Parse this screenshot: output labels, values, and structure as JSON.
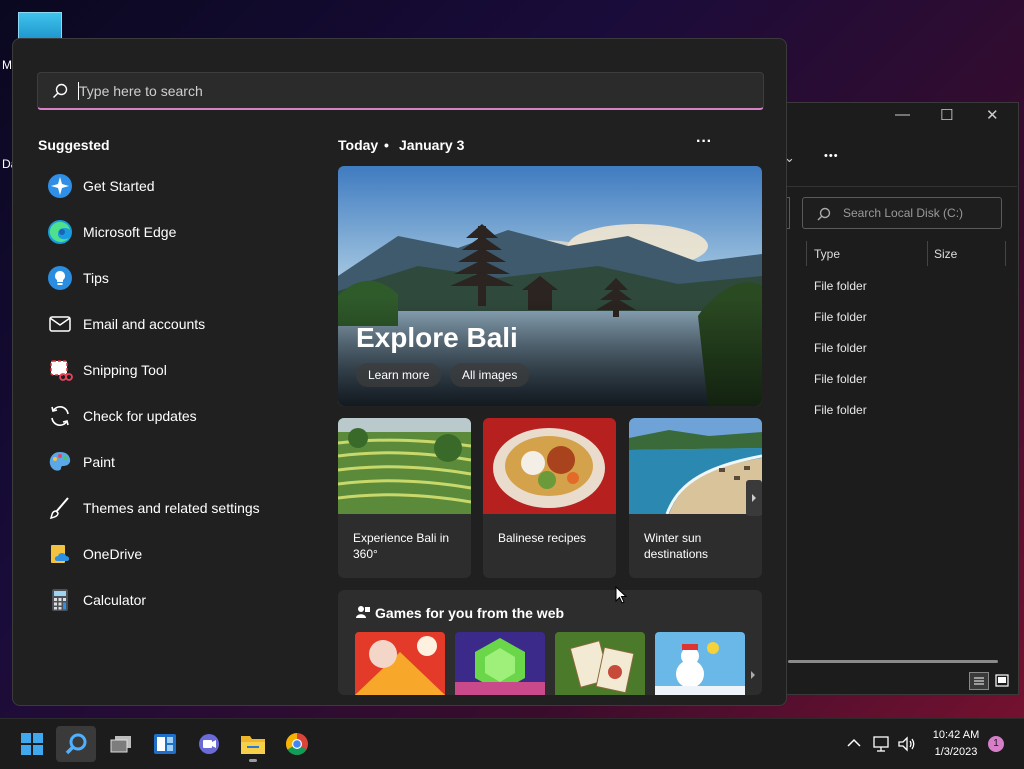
{
  "desktop": {
    "left_labels": [
      "M",
      "Da"
    ]
  },
  "explorer": {
    "minimize": "—",
    "maximize": "☐",
    "close": "✕",
    "chevron": "⌄",
    "more": "•••",
    "search_placeholder": "Search Local Disk (C:)",
    "columns": [
      "Type",
      "Size"
    ],
    "rows": [
      "File folder",
      "File folder",
      "File folder",
      "File folder",
      "File folder"
    ]
  },
  "start": {
    "search_placeholder": "Type here to search",
    "suggested_title": "Suggested",
    "suggested": [
      {
        "label": "Get Started",
        "icon": "get-started-icon"
      },
      {
        "label": "Microsoft Edge",
        "icon": "edge-icon"
      },
      {
        "label": "Tips",
        "icon": "tips-icon"
      },
      {
        "label": "Email and accounts",
        "icon": "email-icon"
      },
      {
        "label": "Snipping Tool",
        "icon": "snipping-tool-icon"
      },
      {
        "label": "Check for updates",
        "icon": "refresh-icon"
      },
      {
        "label": "Paint",
        "icon": "paint-icon"
      },
      {
        "label": "Themes and related settings",
        "icon": "brush-icon"
      },
      {
        "label": "OneDrive",
        "icon": "onedrive-icon"
      },
      {
        "label": "Calculator",
        "icon": "calculator-icon"
      }
    ],
    "today": {
      "label": "Today",
      "bullet": "•",
      "date": "January 3",
      "more": "···"
    },
    "hero": {
      "title": "Explore Bali",
      "learn_more": "Learn more",
      "all_images": "All images"
    },
    "cards": [
      "Experience Bali in 360°",
      "Balinese recipes",
      "Winter sun destinations"
    ],
    "games_title": "Games for you from the web"
  },
  "taskbar": {
    "time": "10:42 AM",
    "date": "1/3/2023",
    "notification_count": "1"
  },
  "colors": {
    "accent": "#d782c8",
    "panel": "#202020",
    "taskbar": "#1c1c1c"
  }
}
